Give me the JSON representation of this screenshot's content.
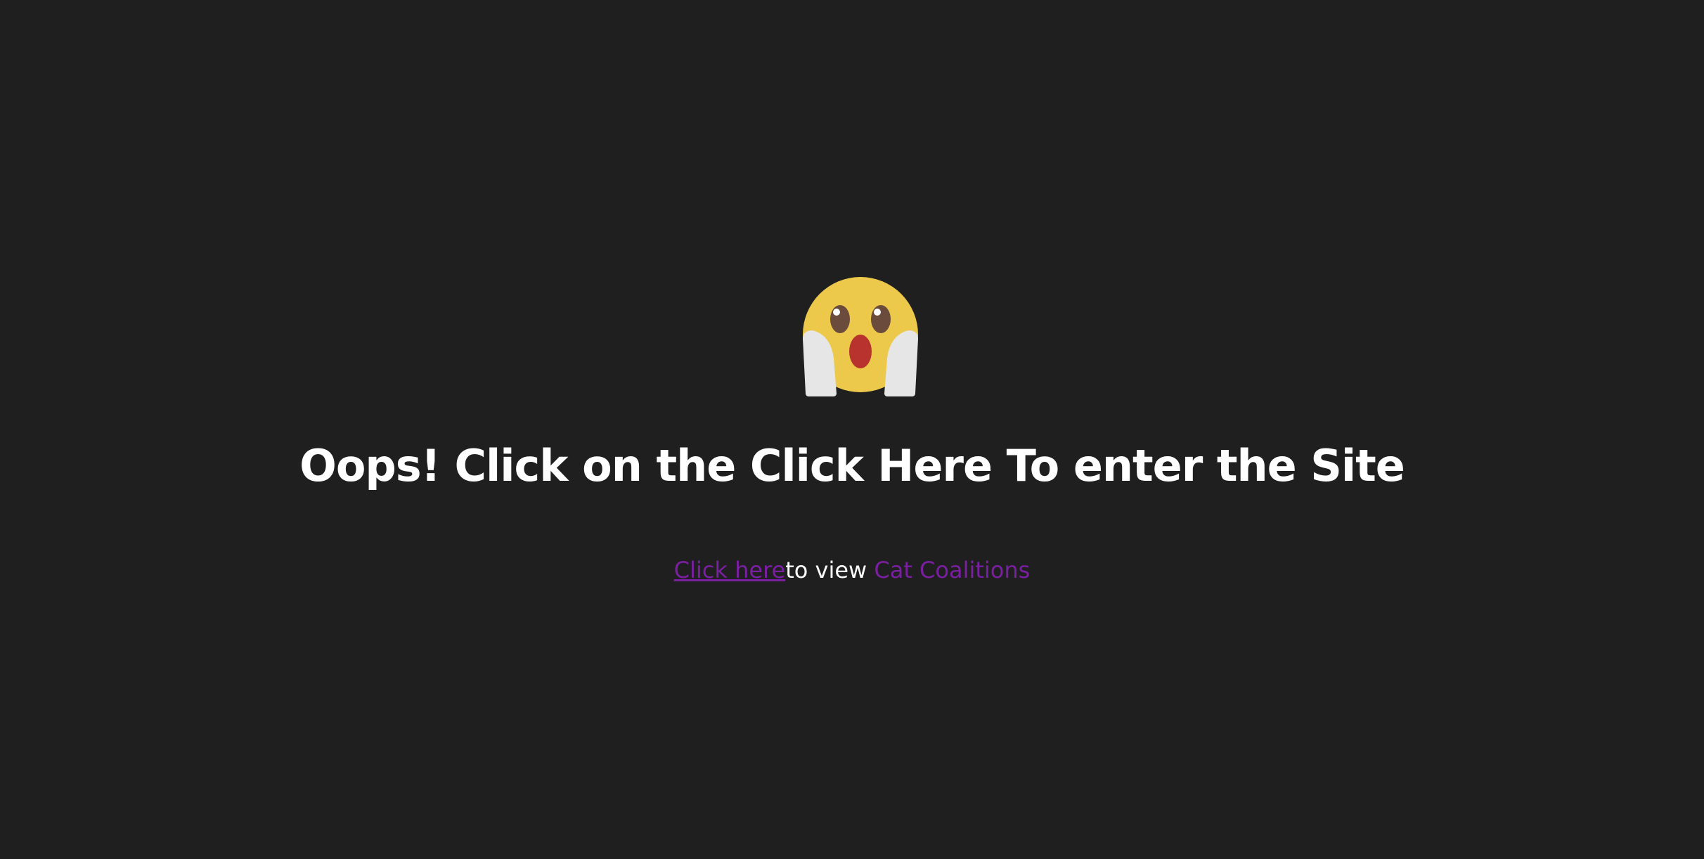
{
  "emoji": {
    "icon": "face-screaming-in-fear-icon",
    "colors": {
      "face": "#ecc94b",
      "hands": "#e6e6e6",
      "eyes": "#6b4b3b",
      "mouth": "#b8332e"
    }
  },
  "headline": "Oops! Click on the Click Here To enter the Site",
  "subline": {
    "link_text": "Click here",
    "middle_text": "to view ",
    "site_name": "Cat Coalitions"
  },
  "colors": {
    "background": "#1f1f1f",
    "text": "#ffffff",
    "link": "#7b1fa2"
  }
}
